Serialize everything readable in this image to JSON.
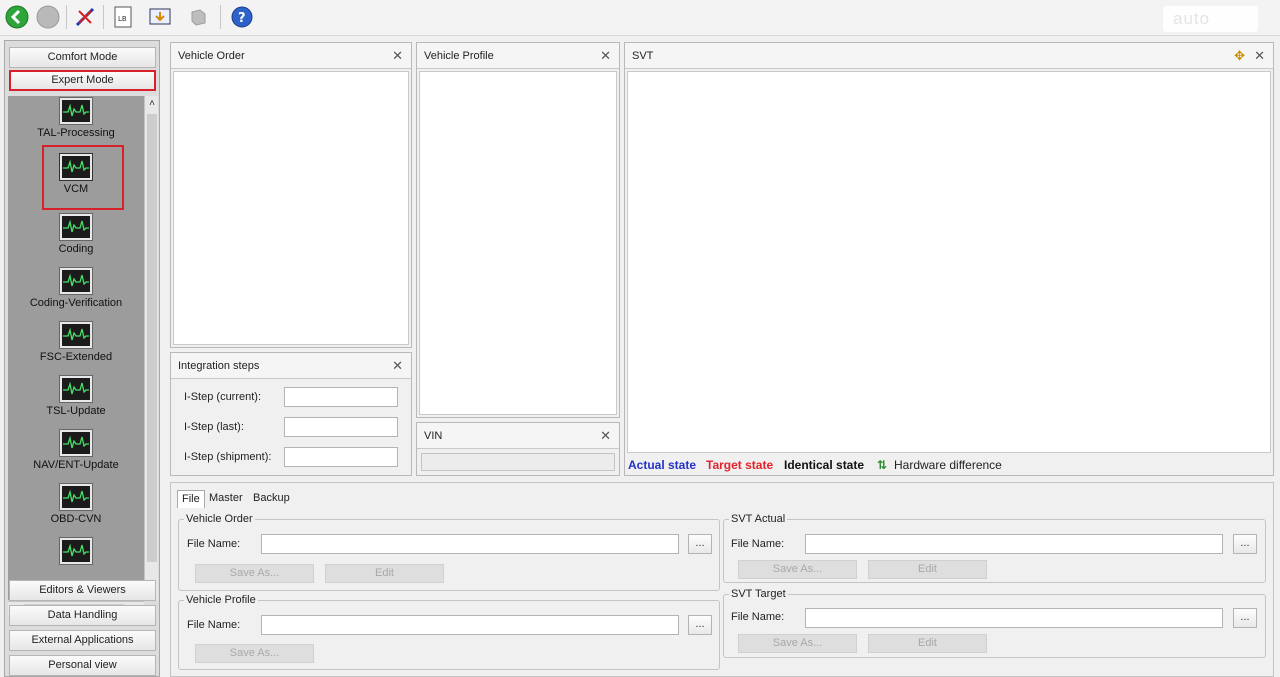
{
  "toolbar": {
    "buttons": [
      {
        "icon": "back-icon"
      },
      {
        "icon": "stop-icon"
      },
      {
        "icon": "connect-icon"
      },
      {
        "icon": "log-icon"
      },
      {
        "icon": "export-icon"
      },
      {
        "icon": "plugin-icon"
      },
      {
        "icon": "help-icon"
      }
    ],
    "watermark_text": "auto"
  },
  "leftnav": {
    "comfort_mode": "Comfort Mode",
    "expert_mode": "Expert Mode",
    "tools": [
      {
        "label": "TAL-Processing"
      },
      {
        "label": "VCM"
      },
      {
        "label": "Coding"
      },
      {
        "label": "Coding-Verification"
      },
      {
        "label": "FSC-Extended"
      },
      {
        "label": "TSL-Update"
      },
      {
        "label": "NAV/ENT-Update"
      },
      {
        "label": "OBD-CVN"
      }
    ],
    "selected_tool": "VCM",
    "bottom_buttons": [
      "Editors & Viewers",
      "Data Handling",
      "External Applications",
      "Personal view"
    ]
  },
  "panels": {
    "vehicle_order": {
      "title": "Vehicle Order"
    },
    "vehicle_profile": {
      "title": "Vehicle Profile"
    },
    "svt": {
      "title": "SVT"
    },
    "integration_steps": {
      "title": "Integration steps",
      "fields": [
        {
          "label": "I-Step (current):",
          "value": ""
        },
        {
          "label": "I-Step (last):",
          "value": ""
        },
        {
          "label": "I-Step (shipment):",
          "value": ""
        }
      ]
    },
    "vin": {
      "title": "VIN",
      "value": ""
    }
  },
  "legend": {
    "actual": "Actual state",
    "target": "Target state",
    "identical": "Identical state",
    "hardware": "Hardware difference",
    "colors": {
      "actual": "#2431c9",
      "target": "#e2232b",
      "identical": "#111111",
      "hardware": "#222222"
    }
  },
  "bottom": {
    "tabs": [
      "File",
      "Master",
      "Backup"
    ],
    "active_tab": "File",
    "groups": {
      "vehicle_order": {
        "title": "Vehicle Order",
        "file_label": "File Name:",
        "file_value": "",
        "browse": "...",
        "save_as": "Save As...",
        "edit": "Edit"
      },
      "vehicle_profile": {
        "title": "Vehicle Profile",
        "file_label": "File Name:",
        "file_value": "",
        "browse": "...",
        "save_as": "Save As..."
      },
      "svt_actual": {
        "title": "SVT Actual",
        "file_label": "File Name:",
        "file_value": "",
        "browse": "...",
        "save_as": "Save As...",
        "edit": "Edit"
      },
      "svt_target": {
        "title": "SVT Target",
        "file_label": "File Name:",
        "file_value": "",
        "browse": "...",
        "save_as": "Save As...",
        "edit": "Edit"
      }
    }
  }
}
